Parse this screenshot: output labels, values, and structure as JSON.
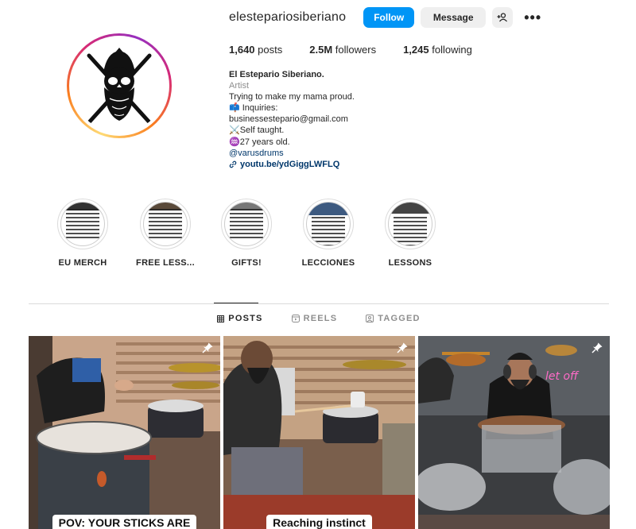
{
  "profile": {
    "username": "elesteparіosiberiano",
    "follow_label": "Follow",
    "message_label": "Message",
    "more_label": "•••",
    "stats": {
      "posts_count": "1,640",
      "posts_label": "posts",
      "followers_count": "2.5M",
      "followers_label": "followers",
      "following_count": "1,245",
      "following_label": "following"
    },
    "bio": {
      "name": "El Estepario Siberiano.",
      "category": "Artist",
      "line1": "Trying to make my mama proud.",
      "line2": "📫 Inquiries:",
      "line3": "businessestepario@gmail.com",
      "line4": "⚔️Self taught.",
      "line5": "♒27 years old.",
      "mention": "@varusdrums",
      "link": "youtu.be/ydGiggLWFLQ"
    }
  },
  "highlights": [
    {
      "label": "EU MERCH"
    },
    {
      "label": "FREE LESS..."
    },
    {
      "label": "GIFTS!"
    },
    {
      "label": "LECCIONES"
    },
    {
      "label": "LESSONS"
    }
  ],
  "tabs": [
    {
      "label": "POSTS",
      "icon": "grid-icon",
      "active": true
    },
    {
      "label": "REELS",
      "icon": "reels-icon",
      "active": false
    },
    {
      "label": "TAGGED",
      "icon": "tagged-icon",
      "active": false
    }
  ],
  "posts": [
    {
      "caption": "POV: YOUR STICKS ARE",
      "pinned": true
    },
    {
      "caption": "Reaching instinct",
      "pinned": true
    },
    {
      "caption": "",
      "pinned": true
    }
  ],
  "colors": {
    "accent": "#0095f6",
    "link": "#00376b",
    "muted": "#8e8e8e"
  }
}
